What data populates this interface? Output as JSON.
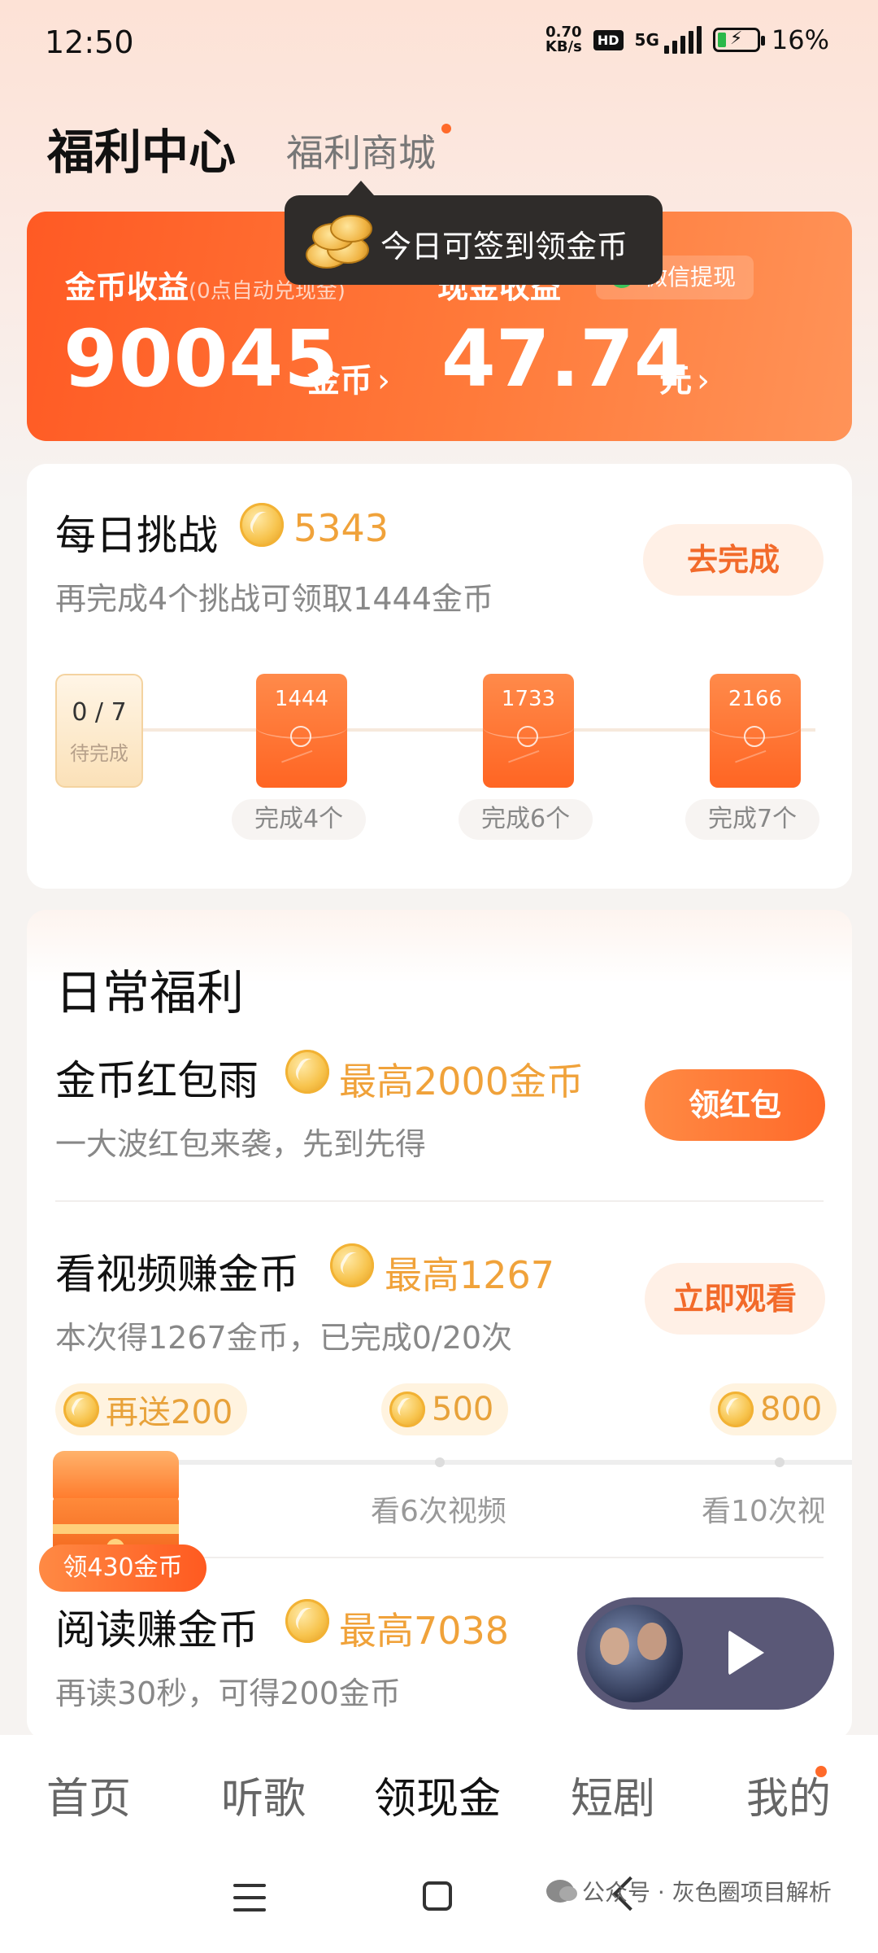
{
  "status_bar": {
    "time": "12:50",
    "net_speed": "0.70",
    "net_unit": "KB/s",
    "hd": "HD",
    "network": "5G",
    "battery_pct": "16%"
  },
  "header": {
    "title": "福利中心",
    "mall": "福利商城"
  },
  "tooltip": {
    "text": "今日可签到领金币"
  },
  "earnings": {
    "coins_label": "金币收益",
    "coins_note": "(0点自动兑现金)",
    "cash_label": "现金收益",
    "wechat": "微信提现",
    "coins_value": "90045",
    "coins_unit": "金币",
    "cash_value": "47.74",
    "cash_unit": "元",
    "chevron": "›"
  },
  "daily_challenge": {
    "title": "每日挑战",
    "coins": "5343",
    "subtitle": "再完成4个挑战可领取1444金币",
    "button": "去完成",
    "progress": "0 / 7",
    "progress_status": "待完成",
    "milestones": [
      {
        "amount": "1444",
        "label": "完成4个"
      },
      {
        "amount": "1733",
        "label": "完成6个"
      },
      {
        "amount": "2166",
        "label": "完成7个"
      }
    ]
  },
  "daily_benefits": {
    "title": "日常福利",
    "rain": {
      "title": "金币红包雨",
      "highlight": "最高2000金币",
      "subtitle": "一大波红包来袭，先到先得",
      "button": "领红包"
    },
    "video": {
      "title": "看视频赚金币",
      "highlight": "最高1267",
      "subtitle": "本次得1267金币，已完成0/20次",
      "button": "立即观看",
      "bonuses": [
        "再送200",
        "500",
        "800"
      ],
      "steps": [
        "看6次视频",
        "看10次视"
      ]
    },
    "chest_label": "领430金币",
    "read": {
      "title": "阅读赚金币",
      "highlight": "最高7038",
      "subtitle": "再读30秒，可得200金币"
    }
  },
  "tabs": [
    "首页",
    "听歌",
    "领现金",
    "短剧",
    "我的"
  ],
  "active_tab": "领现金",
  "watermark": "公众号 · 灰色圈项目解析",
  "colors": {
    "accent": "#ff6a2a",
    "gold": "#f0a23a",
    "active_text": "#111111"
  },
  "icons": [
    "coin-icon",
    "red-envelope-icon",
    "treasure-chest-icon",
    "play-icon",
    "menu-icon",
    "home-icon",
    "back-icon",
    "wechat-icon"
  ]
}
